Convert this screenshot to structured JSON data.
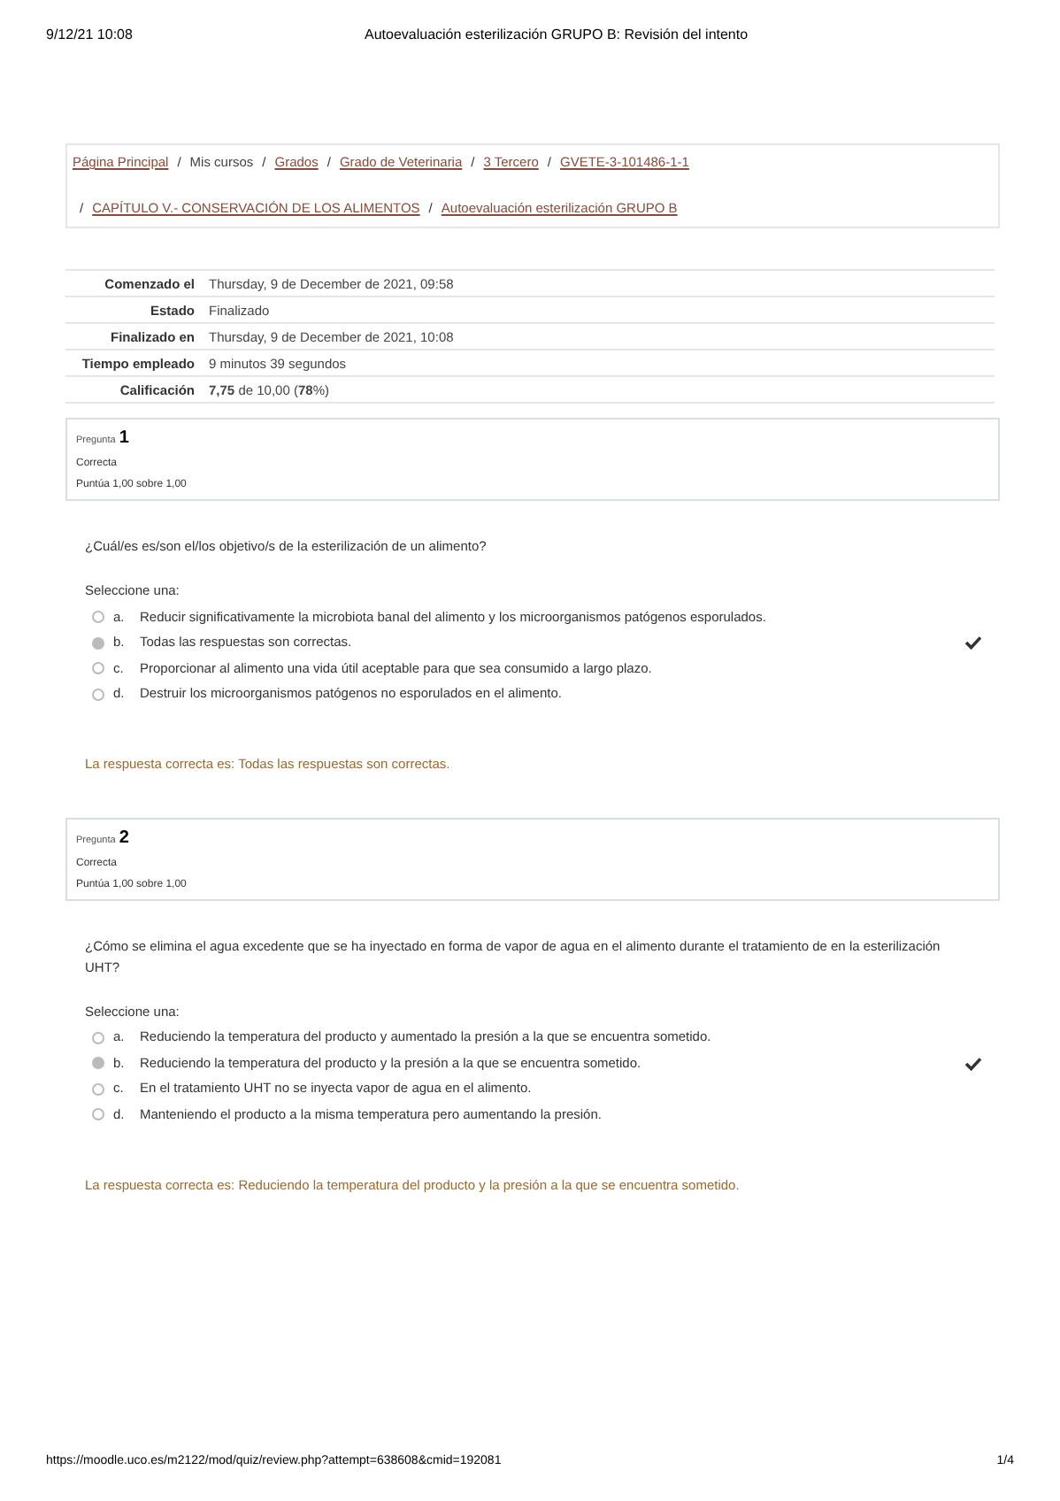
{
  "print_header": {
    "date": "9/12/21 10:08",
    "title": "Autoevaluación esterilización GRUPO B: Revisión del intento"
  },
  "breadcrumb": [
    {
      "label": "Página Principal",
      "link": true
    },
    {
      "separator": "/",
      "label": "Mis cursos",
      "link": false
    },
    {
      "separator": "/",
      "label": "Grados",
      "link": true
    },
    {
      "separator": "/",
      "label": "Grado de Veterinaria",
      "link": true
    },
    {
      "separator": "/",
      "label": "3 Tercero",
      "link": true
    },
    {
      "separator": "/",
      "label": "GVETE-3-101486-1-1",
      "link": true
    },
    {
      "separator": "/",
      "label": "CAPÍTULO V.- CONSERVACIÓN DE LOS ALIMENTOS",
      "link": true
    },
    {
      "separator": "/",
      "label": "Autoevaluación esterilización GRUPO B",
      "link": true
    }
  ],
  "summary": [
    {
      "label": "Comenzado el",
      "value": "Thursday, 9 de December de 2021, 09:58"
    },
    {
      "label": "Estado",
      "value": "Finalizado"
    },
    {
      "label": "Finalizado en",
      "value": "Thursday, 9 de December de 2021, 10:08"
    },
    {
      "label": "Tiempo empleado",
      "value": "9 minutos 39 segundos"
    },
    {
      "label": "Calificación",
      "value": "**7,75** de 10,00 (**78**%)"
    }
  ],
  "questions": [
    {
      "label": "Pregunta",
      "number": "1",
      "status": "Correcta",
      "score": "Puntúa 1,00 sobre 1,00",
      "text": "¿Cuál/es es/son el/los objetivo/s de la esterilización de un alimento?",
      "prompt": "Seleccione una:",
      "options": [
        {
          "letter": "a.",
          "text": "Reducir significativamente la microbiota banal del alimento y los microorganismos patógenos esporulados.",
          "selected": false,
          "correct": false
        },
        {
          "letter": "b.",
          "text": "Todas las respuestas son correctas.",
          "selected": true,
          "correct": true
        },
        {
          "letter": "c.",
          "text": "Proporcionar al alimento una vida útil aceptable para que sea consumido a largo plazo.",
          "selected": false,
          "correct": false
        },
        {
          "letter": "d.",
          "text": "Destruir los microorganismos patógenos no esporulados en el alimento.",
          "selected": false,
          "correct": false
        }
      ],
      "feedback": "La respuesta correcta es: Todas las respuestas son correctas."
    },
    {
      "label": "Pregunta",
      "number": "2",
      "status": "Correcta",
      "score": "Puntúa 1,00 sobre 1,00",
      "text": "¿Cómo se elimina el agua excedente que se ha inyectado en forma de vapor de agua en el alimento durante el tratamiento de en la esterilización UHT?",
      "prompt": "Seleccione una:",
      "options": [
        {
          "letter": "a.",
          "text": "Reduciendo la temperatura del producto y aumentado la presión a la que se encuentra sometido.",
          "selected": false,
          "correct": false
        },
        {
          "letter": "b.",
          "text": "Reduciendo la temperatura del producto y la presión a la que se encuentra sometido.",
          "selected": true,
          "correct": true
        },
        {
          "letter": "c.",
          "text": "En el tratamiento UHT no se inyecta vapor de agua en el alimento.",
          "selected": false,
          "correct": false
        },
        {
          "letter": "d.",
          "text": "Manteniendo el producto a la misma temperatura pero aumentando la presión.",
          "selected": false,
          "correct": false
        }
      ],
      "feedback": "La respuesta correcta es: Reduciendo la temperatura del producto y la presión a la que se encuentra sometido."
    }
  ],
  "print_footer": {
    "url": "https://moodle.uco.es/m2122/mod/quiz/review.php?attempt=638608&cmid=192081",
    "page": "1/4"
  }
}
